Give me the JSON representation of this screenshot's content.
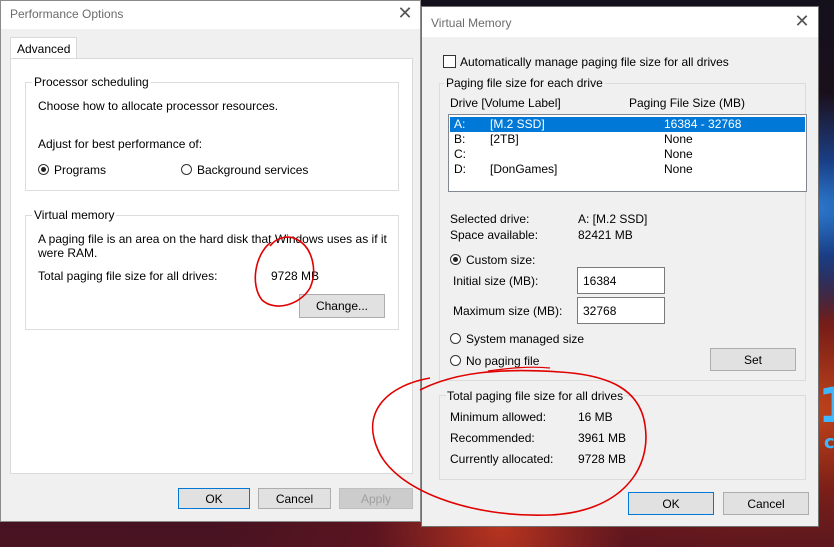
{
  "perf": {
    "title": "Performance Options",
    "tab": "Advanced",
    "proc_group": "Processor scheduling",
    "proc_desc": "Choose how to allocate processor resources.",
    "adjust_label": "Adjust for best performance of:",
    "radio_programs": "Programs",
    "radio_background": "Background services",
    "vm_group": "Virtual memory",
    "vm_desc": "A paging file is an area on the hard disk that Windows uses as if it were RAM.",
    "total_label": "Total paging file size for all drives:",
    "total_value": "9728 MB",
    "change_btn": "Change...",
    "ok": "OK",
    "cancel": "Cancel",
    "apply": "Apply"
  },
  "vm": {
    "title": "Virtual Memory",
    "auto_manage": "Automatically manage paging file size for all drives",
    "each_drive_group": "Paging file size for each drive",
    "col_drive": "Drive  [Volume Label]",
    "col_size": "Paging File Size (MB)",
    "drives": [
      {
        "drive": "A:",
        "label": "[M.2 SSD]",
        "size": "16384 - 32768"
      },
      {
        "drive": "B:",
        "label": "[2TB]",
        "size": "None"
      },
      {
        "drive": "C:",
        "label": "",
        "size": "None"
      },
      {
        "drive": "D:",
        "label": "[DonGames]",
        "size": "None"
      }
    ],
    "selected_drive_label": "Selected drive:",
    "selected_drive_value": "A:  [M.2 SSD]",
    "space_label": "Space available:",
    "space_value": "82421 MB",
    "custom_size": "Custom size:",
    "initial_label": "Initial size (MB):",
    "initial_value": "16384",
    "max_label": "Maximum size (MB):",
    "max_value": "32768",
    "system_managed": "System managed size",
    "no_paging": "No paging file",
    "set_btn": "Set",
    "totals_group": "Total paging file size for all drives",
    "min_label": "Minimum allowed:",
    "min_value": "16 MB",
    "rec_label": "Recommended:",
    "rec_value": "3961 MB",
    "cur_label": "Currently allocated:",
    "cur_value": "9728 MB",
    "ok": "OK",
    "cancel": "Cancel"
  },
  "background_text": [
    "1",
    "c"
  ],
  "colors": {
    "selection": "#0078d7",
    "annotation": "#e00000"
  }
}
